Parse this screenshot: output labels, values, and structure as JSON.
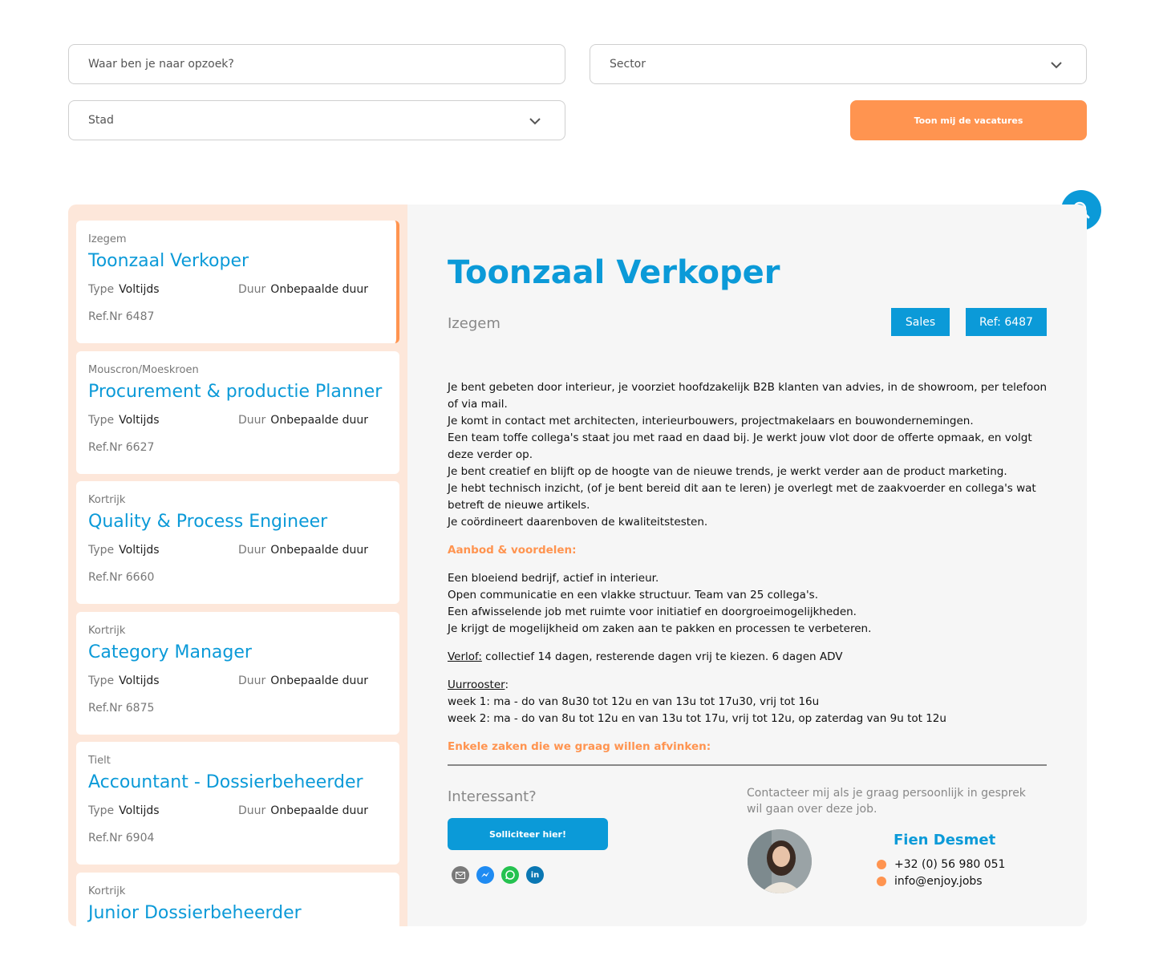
{
  "search": {
    "placeholder": "Waar ben je naar opzoek?",
    "value": ""
  },
  "filters": {
    "sector": {
      "selected": "Sector",
      "icon": "chevron-down-icon"
    },
    "stad": {
      "selected": "Stad",
      "icon": "chevron-down-icon"
    }
  },
  "show_button": "Toon mij de vacatures",
  "labels": {
    "type": "Type",
    "duur": "Duur",
    "ref_prefix": "Ref.Nr"
  },
  "jobs": [
    {
      "city": "Izegem",
      "title": "Toonzaal Verkoper",
      "type": "Voltijds",
      "duur": "Onbepaalde duur",
      "ref": "6487"
    },
    {
      "city": "Mouscron/Moeskroen",
      "title": "Procurement & productie Planner",
      "type": "Voltijds",
      "duur": "Onbepaalde duur",
      "ref": "6627"
    },
    {
      "city": "Kortrijk",
      "title": "Quality & Process Engineer",
      "type": "Voltijds",
      "duur": "Onbepaalde duur",
      "ref": "6660"
    },
    {
      "city": "Kortrijk",
      "title": "Category Manager",
      "type": "Voltijds",
      "duur": "Onbepaalde duur",
      "ref": "6875"
    },
    {
      "city": "Tielt",
      "title": "Accountant - Dossierbeheerder",
      "type": "Voltijds",
      "duur": "Onbepaalde duur",
      "ref": "6904"
    },
    {
      "city": "Kortrijk",
      "title": "Junior Dossierbeheerder",
      "type": "",
      "duur": "",
      "ref": ""
    }
  ],
  "detail": {
    "title": "Toonzaal Verkoper",
    "city": "Izegem",
    "tag_sector": "Sales",
    "tag_ref": "Ref: 6487",
    "description": [
      "Je bent gebeten door interieur, je voorziet hoofdzakelijk B2B klanten van advies, in de showroom, per telefoon of via mail.",
      "Je komt in contact met architecten, interieurbouwers, projectmakelaars en bouwondernemingen.",
      "Een team toffe collega's staat jou met raad en daad bij. Je werkt jouw vlot door de offerte opmaak, en volgt deze verder op.",
      "Je bent creatief en blijft op de hoogte van de nieuwe trends, je werkt verder aan de product marketing.",
      "Je hebt technisch inzicht, (of je bent bereid dit aan te leren) je overlegt met de zaakvoerder en collega's wat betreft de nieuwe artikels.",
      "Je coördineert daarenboven de kwaliteitstesten."
    ],
    "offer_heading": "Aanbod & voordelen:",
    "offer": [
      "Een bloeiend bedrijf, actief in interieur.",
      "Open communicatie en een vlakke structuur. Team van 25 collega's.",
      "Een afwisselende job met ruimte voor initiatief en doorgroeimogelijkheden.",
      "Je krijgt de mogelijkheid om zaken aan te pakken en processen te verbeteren."
    ],
    "verlof_label": "Verlof:",
    "verlof_text": " collectief 14 dagen, resterende dagen vrij te kiezen. 6 dagen ADV",
    "uurrooster_label": "Uurrooster",
    "uurrooster_colon": ":",
    "week1": "week 1: ma - do van 8u30 tot 12u en van 13u tot 17u30, vrij tot 16u",
    "week2": "week 2: ma - do van 8u tot 12u en van 13u tot 17u, vrij tot 12u, op zaterdag van 9u tot 12u",
    "checklist_heading": "Enkele zaken die we graag willen afvinken:",
    "interessant": "Interessant?",
    "apply_button": "Solliciteer hier!",
    "share_icons": [
      "mail-icon",
      "messenger-icon",
      "whatsapp-icon",
      "linkedin-icon"
    ],
    "contact_text": "Contacteer mij als je graag persoonlijk in gesprek wil gaan over deze job.",
    "contact_name": "Fien Desmet",
    "contact_phone": "+32 (0) 56 980 051",
    "contact_email": "info@enjoy.jobs"
  },
  "colors": {
    "accent_blue": "#0b9ad8",
    "accent_orange": "#ff9450",
    "panel_peach": "#fde7da"
  }
}
